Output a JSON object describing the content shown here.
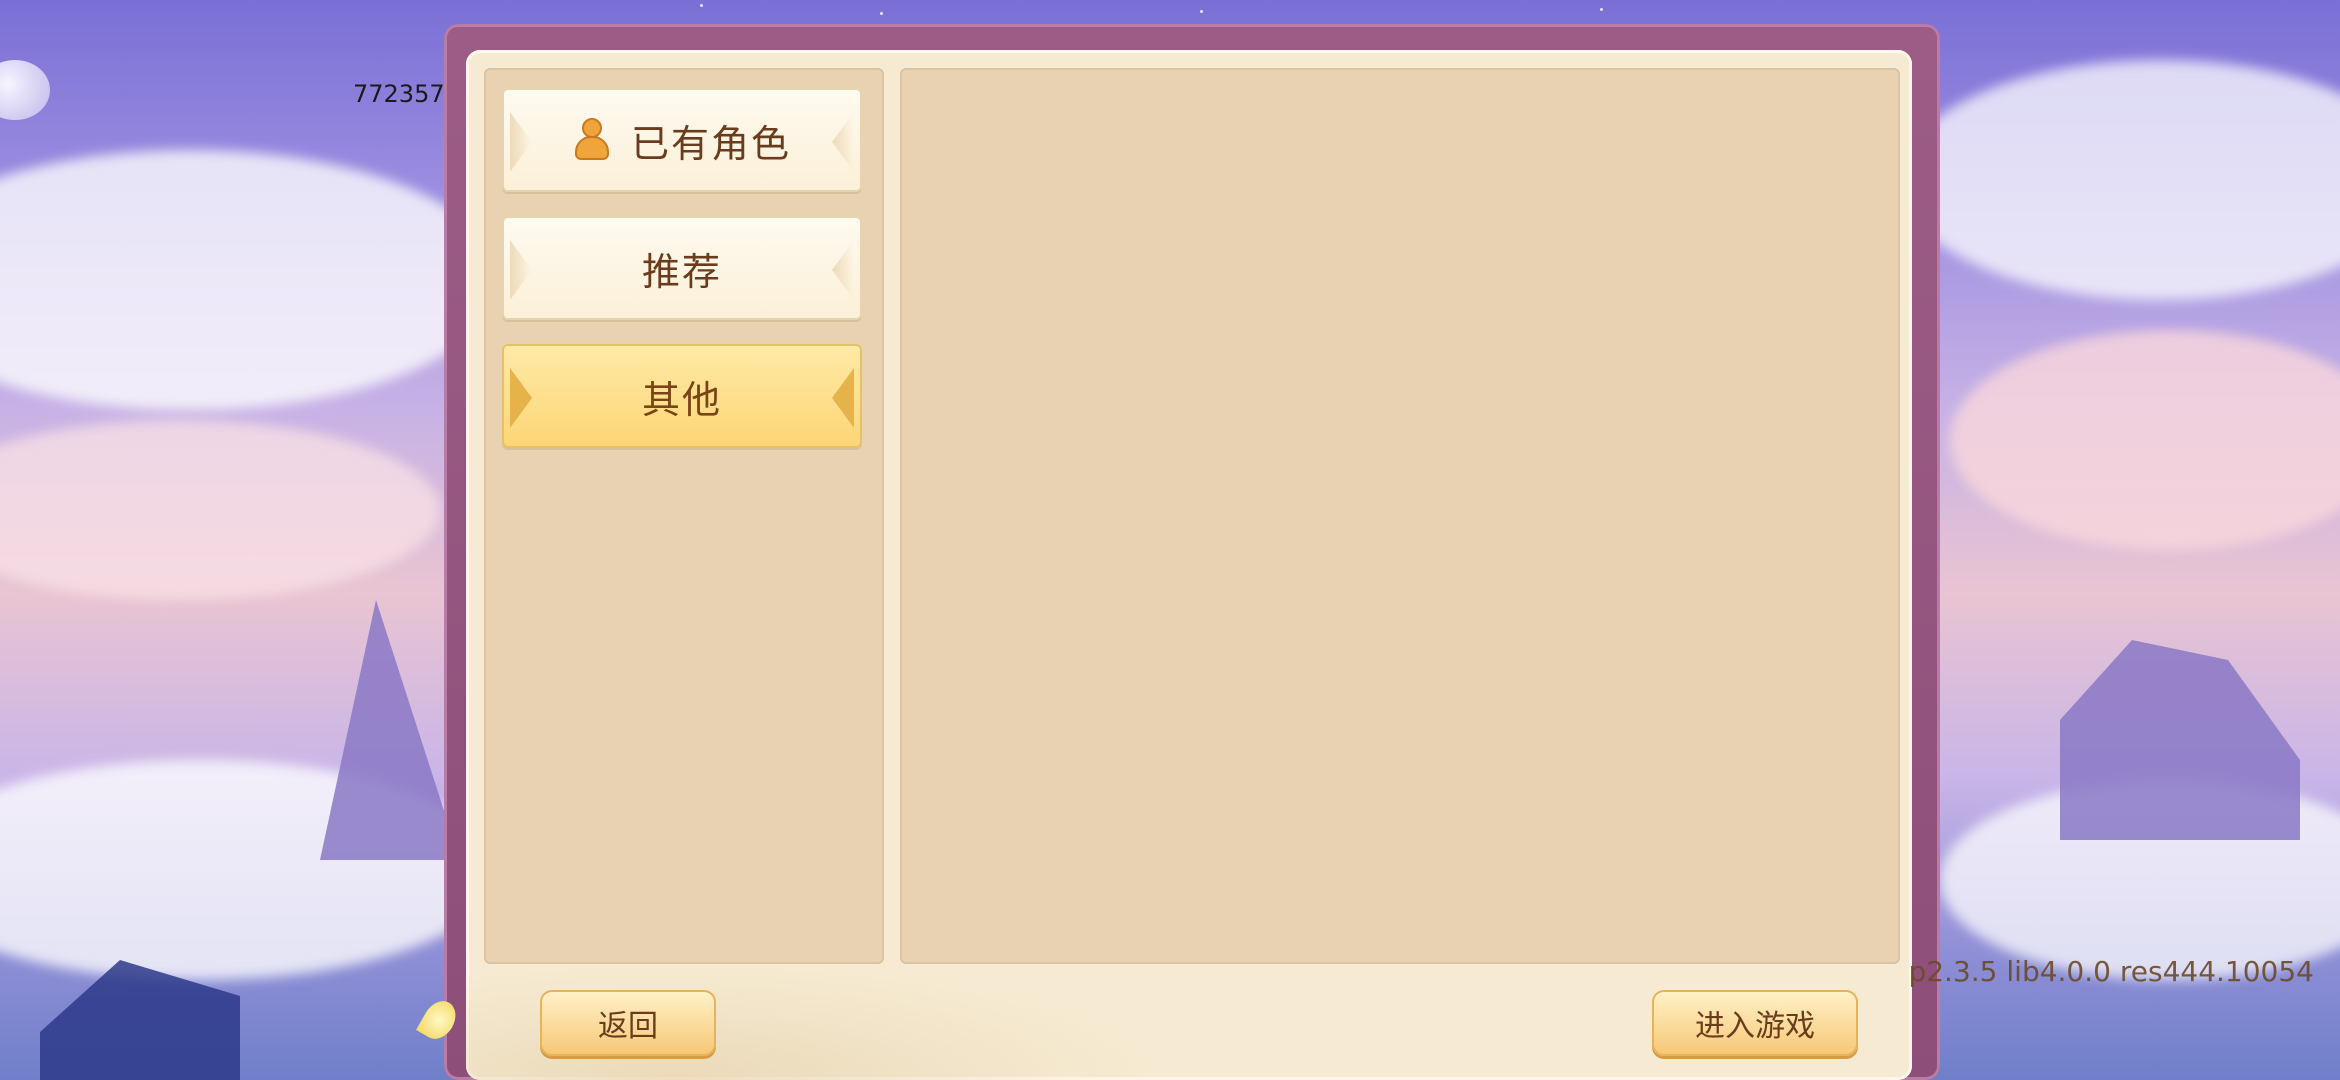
{
  "uid": "772357",
  "version": "p2.3.5 lib4.0.0 res444.10054",
  "tabs": [
    {
      "label": "已有角色",
      "icon": "person-icon",
      "active": false
    },
    {
      "label": "推荐",
      "active": false
    },
    {
      "label": "其他",
      "active": true
    }
  ],
  "buttons": {
    "back": "返回",
    "enter": "进入游戏"
  },
  "colors": {
    "panel": "#f6ebd2",
    "frame": "#9c5c86",
    "content_bg": "#e8d2b2",
    "active_tab": "#fcd676",
    "text": "#6b3c1c"
  }
}
